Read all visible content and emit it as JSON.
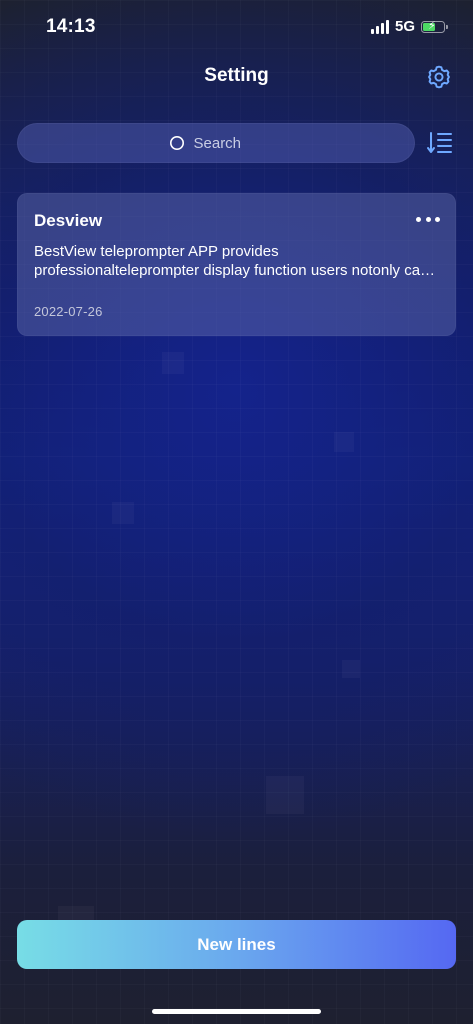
{
  "status_bar": {
    "time": "14:13",
    "network": "5G"
  },
  "header": {
    "title": "Setting",
    "settings_icon": "gear-icon"
  },
  "search": {
    "placeholder": "Search",
    "sort_icon": "sort-list-icon"
  },
  "scripts": [
    {
      "title": "Desview",
      "preview": "BestView teleprompter APP provides professionalteleprompter display function users notonly can adjust the font size and scrolling speed",
      "date": "2022-07-26"
    }
  ],
  "footer": {
    "new_button_label": "New lines"
  },
  "colors": {
    "accent_gradient_start": "#77dde6",
    "accent_gradient_end": "#5568f2",
    "icon_accent": "#6ea8ff",
    "battery_green": "#4cd964"
  }
}
